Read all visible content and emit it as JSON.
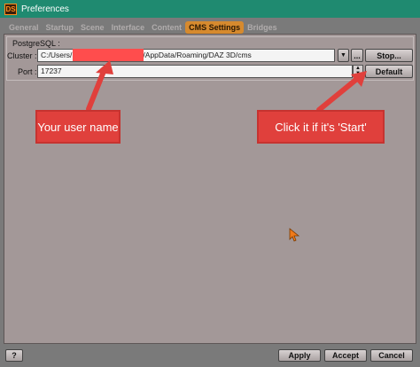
{
  "window": {
    "icon_label": "DS",
    "title": "Preferences"
  },
  "tabs": [
    "General",
    "Startup",
    "Scene",
    "Interface",
    "Content",
    "CMS Settings",
    "Bridges"
  ],
  "active_tab": "CMS Settings",
  "group": {
    "label": "PostgreSQL :"
  },
  "cluster": {
    "label": "Cluster :",
    "value_prefix": "C:/Users/",
    "value_suffix": "/AppData/Roaming/DAZ 3D/cms",
    "browse_label": "...",
    "stop_label": "Stop..."
  },
  "port": {
    "label": "Port :",
    "value": "17237",
    "default_label": "Default"
  },
  "annotations": {
    "user_name": "Your user name",
    "start_hint": "Click it if it's 'Start'"
  },
  "footer": {
    "help_label": "?",
    "apply_label": "Apply",
    "accept_label": "Accept",
    "cancel_label": "Cancel"
  },
  "colors": {
    "titlebar": "#1f8a70",
    "active_tab": "#d68a2e",
    "callout": "#e0403c",
    "panel": "#a39898"
  }
}
